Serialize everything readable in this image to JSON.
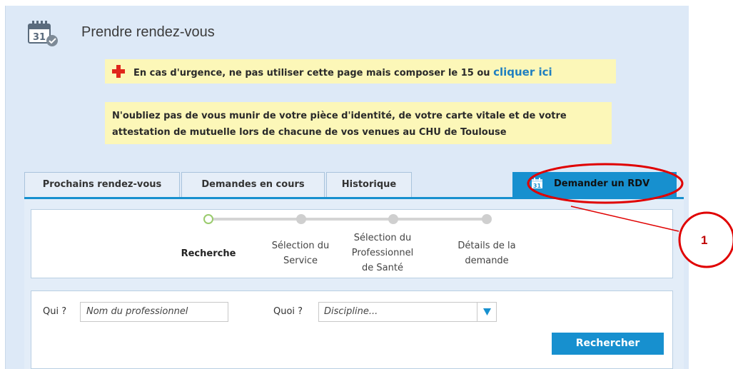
{
  "header": {
    "title": "Prendre rendez-vous",
    "calendar_icon_day": "31"
  },
  "alerts": {
    "urgent_text": "En cas d'urgence, ne pas utiliser cette page mais composer le 15 ou",
    "urgent_link": "cliquer ici",
    "reminder_text": "N'oubliez pas de vous munir de votre pièce d'identité, de votre carte vitale et de votre attestation de mutuelle lors de chacune de vos venues au CHU de Toulouse"
  },
  "tabs": [
    {
      "label": "Prochains rendez-vous"
    },
    {
      "label": "Demandes en cours"
    },
    {
      "label": "Historique"
    },
    {
      "label": "Demander un RDV",
      "active": true
    }
  ],
  "steps": [
    {
      "label_lines": [
        "Recherche"
      ],
      "active": true
    },
    {
      "label_lines": [
        "Sélection du",
        "Service"
      ]
    },
    {
      "label_lines": [
        "Sélection du",
        "Professionnel",
        "de Santé"
      ]
    },
    {
      "label_lines": [
        "Détails de la",
        "demande"
      ]
    }
  ],
  "search": {
    "who_label": "Qui ?",
    "who_placeholder": "Nom du professionnel",
    "what_label": "Quoi ?",
    "what_placeholder": "Discipline...",
    "button_label": "Rechercher"
  },
  "annotation": {
    "number": "1"
  },
  "colors": {
    "accent_blue": "#1790cf",
    "alert_yellow": "#fcf7b8",
    "annotation_red": "#e00000",
    "step_active_green": "#9acb6d"
  }
}
